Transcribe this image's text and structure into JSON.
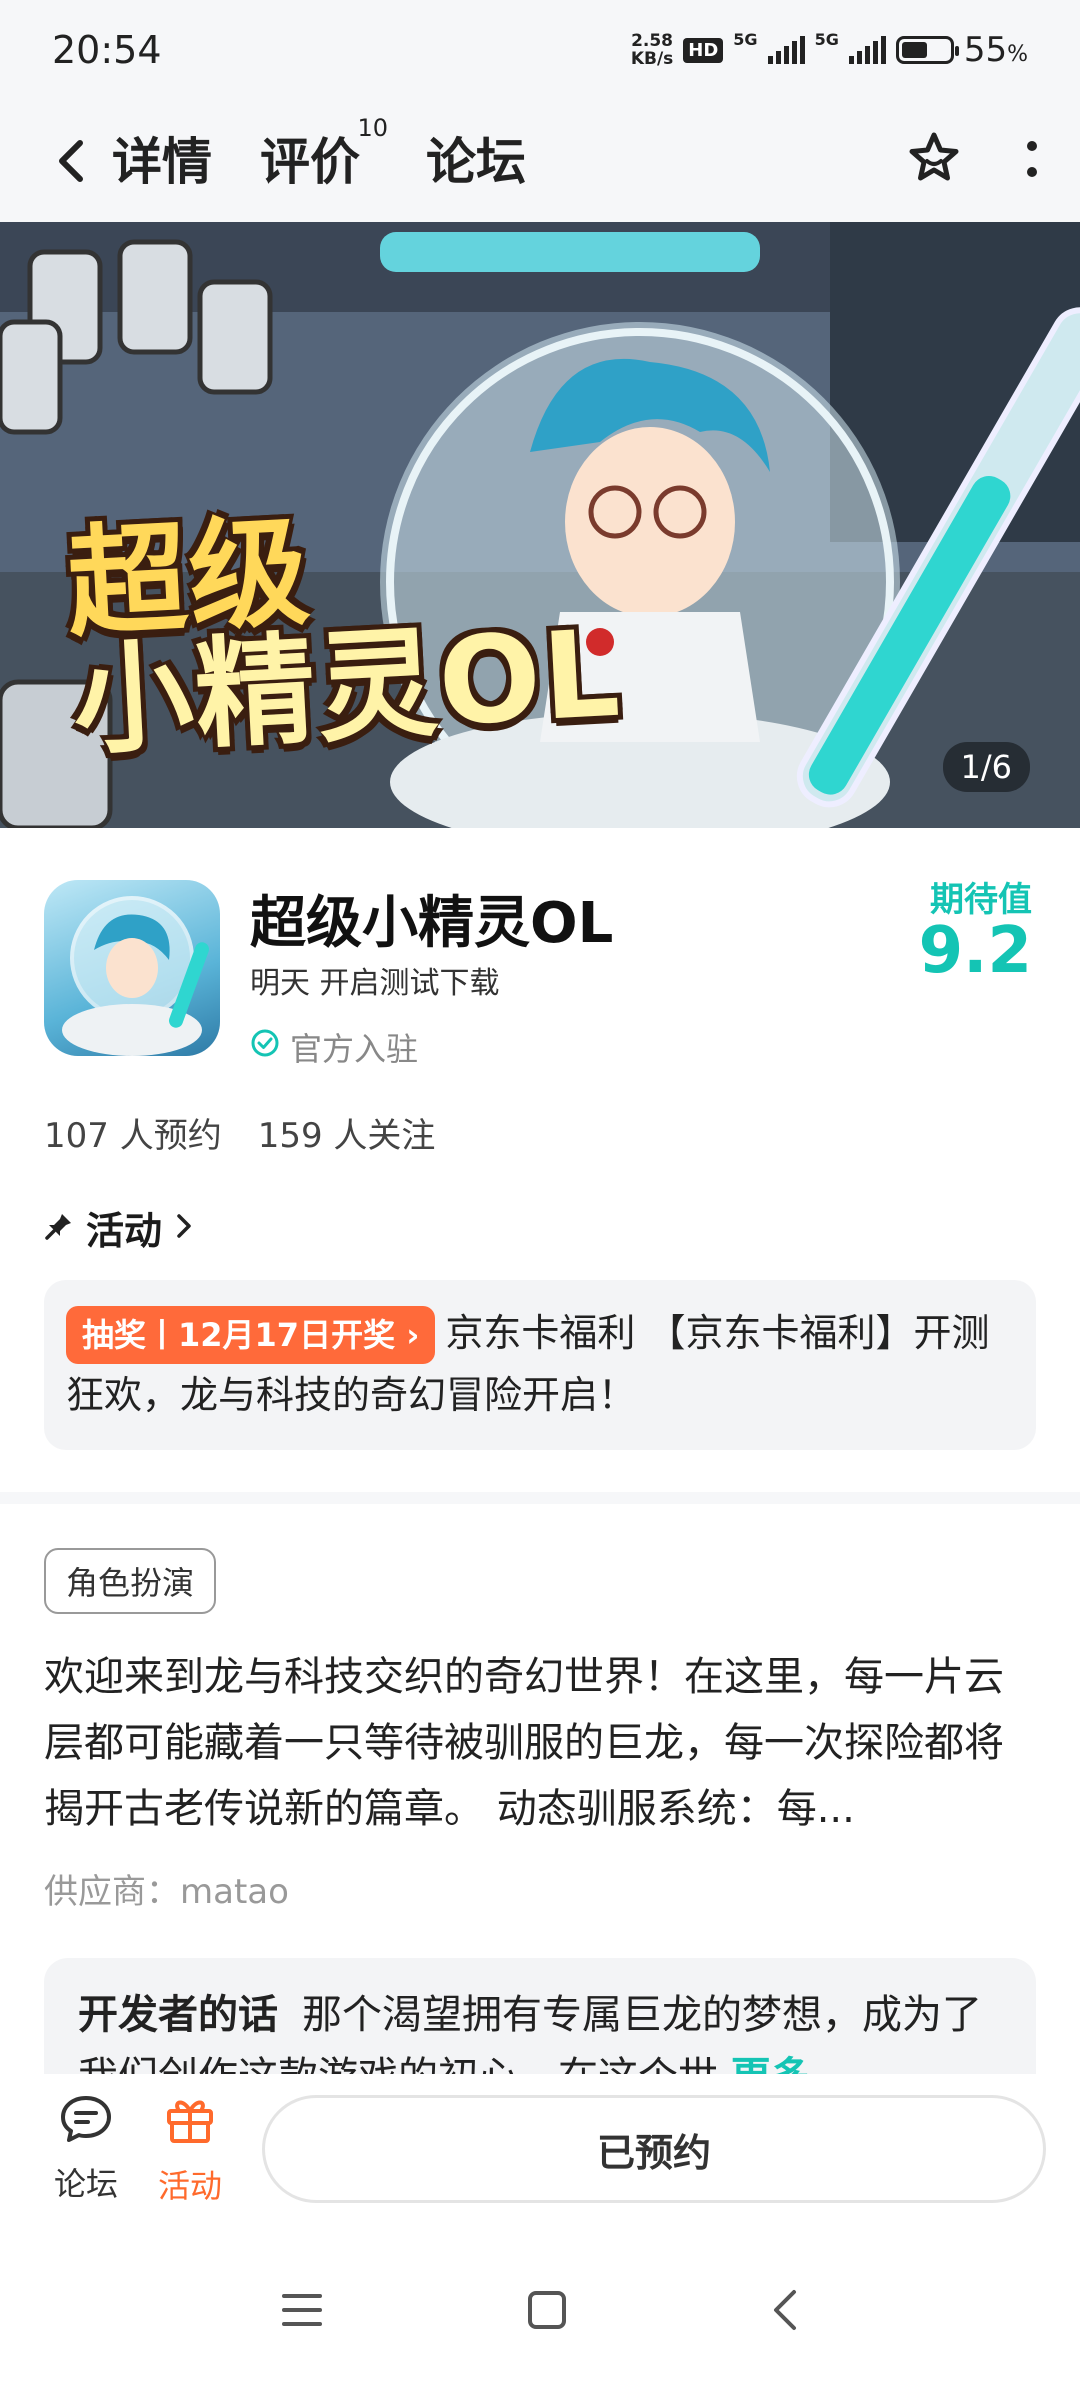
{
  "status_bar": {
    "time": "20:54",
    "net_speed_value": "2.58",
    "net_speed_unit": "KB/s",
    "hd_badge": "HD",
    "sim1_label": "5G",
    "sim2_label": "5G",
    "battery_percent": "55",
    "battery_level": 0.55
  },
  "nav": {
    "tabs": [
      {
        "label": "详情",
        "active": true
      },
      {
        "label": "评价",
        "badge": "10"
      },
      {
        "label": "论坛"
      }
    ]
  },
  "banner": {
    "title_line1": "超级",
    "title_line2": "小精灵OL",
    "page_indicator": "1/6"
  },
  "app": {
    "name": "超级小精灵OL",
    "release": "明天 开启测试下载",
    "official": "官方入驻",
    "expect_label": "期待值",
    "expect_score": "9.2",
    "reservations": "107 人预约",
    "followers": "159 人关注"
  },
  "activity": {
    "heading": "活动",
    "event_tag": "抽奖丨12月17日开奖",
    "event_text": "京东卡福利 【京东卡福利】开测狂欢，龙与科技的奇幻冒险开启！"
  },
  "description": {
    "genre": "角色扮演",
    "text": "欢迎来到龙与科技交织的奇幻世界！在这里，每一片云层都可能藏着一只等待被驯服的巨龙，每一次探险都将揭开古老传说新的篇章。 动态驯服系统：每...",
    "supplier": "供应商：matao",
    "dev_title": "开发者的话",
    "dev_text": "那个渴望拥有专属巨龙的梦想，成为了我们创作这款游戏的初心。在这个世",
    "dev_more": "更多"
  },
  "bottom_bar": {
    "forum_label": "论坛",
    "activity_label": "活动",
    "reserve_label": "已预约"
  },
  "colors": {
    "accent": "#14c4b4",
    "orange": "#ff6a2c",
    "tag_orange": "#ff6a3a"
  }
}
